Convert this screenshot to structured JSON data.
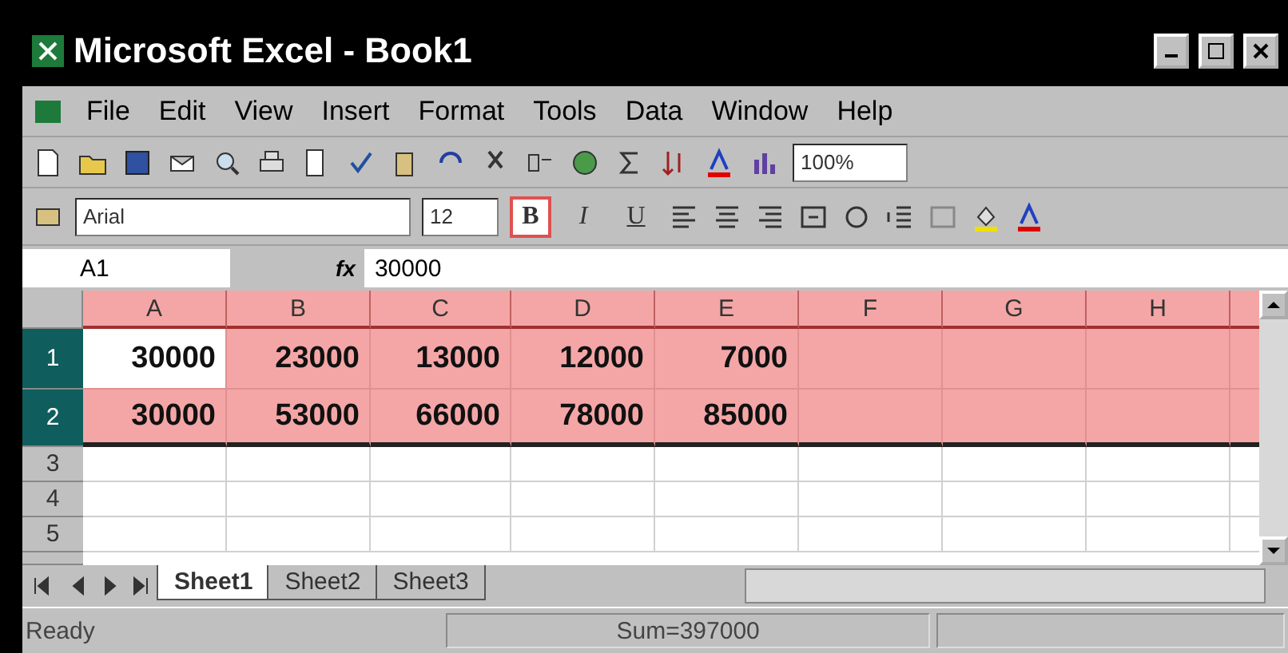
{
  "window": {
    "title": "Microsoft Excel - Book1"
  },
  "menu": [
    "File",
    "Edit",
    "View",
    "Insert",
    "Format",
    "Tools",
    "Data",
    "Window",
    "Help"
  ],
  "standard_toolbar": {
    "zoom": "100%"
  },
  "formatting_toolbar": {
    "font": "Arial",
    "size": "12",
    "styles": [
      {
        "label": "B",
        "selected": true
      },
      {
        "label": "I",
        "selected": false
      },
      {
        "label": "U",
        "selected": false
      }
    ]
  },
  "formula_bar": {
    "name_box": "A1",
    "fx": "fx",
    "value": "30000"
  },
  "columns": [
    {
      "label": "A",
      "selected": true
    },
    {
      "label": "B",
      "selected": true
    },
    {
      "label": "C",
      "selected": true
    },
    {
      "label": "D",
      "selected": true
    },
    {
      "label": "E",
      "selected": true
    },
    {
      "label": "F",
      "selected": true
    },
    {
      "label": "G",
      "selected": true
    },
    {
      "label": "H",
      "selected": true
    }
  ],
  "rows": [
    {
      "label": "1",
      "selected": true,
      "cells": [
        {
          "value": "30000",
          "active": true
        },
        {
          "value": "23000",
          "active": false
        },
        {
          "value": "13000",
          "active": false
        },
        {
          "value": "12000",
          "active": false
        },
        {
          "value": "7000",
          "active": false
        }
      ]
    },
    {
      "label": "2",
      "selected": true,
      "cells": [
        {
          "value": "30000",
          "active": false
        },
        {
          "value": "53000",
          "active": false
        },
        {
          "value": "66000",
          "active": false
        },
        {
          "value": "78000",
          "active": false
        },
        {
          "value": "85000",
          "active": false
        }
      ]
    },
    {
      "label": "3",
      "selected": false,
      "cells": []
    },
    {
      "label": "4",
      "selected": false,
      "cells": []
    },
    {
      "label": "5",
      "selected": false,
      "cells": []
    }
  ],
  "sheet_tabs": [
    {
      "label": "Sheet1",
      "selected": true
    },
    {
      "label": "Sheet2",
      "selected": false
    },
    {
      "label": "Sheet3",
      "selected": false
    }
  ],
  "status_bar": {
    "mode": "Ready",
    "sum": "Sum=397000"
  }
}
